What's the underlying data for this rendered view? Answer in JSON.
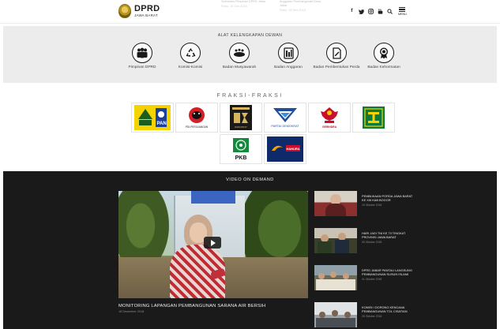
{
  "header": {
    "logo_title": "DPRD",
    "logo_subtitle": "JAWA BARAT",
    "ticker": [
      {
        "title": "Sekretaris Pimpinan DPRD Jabar",
        "date": "Rabu, 19 Des 2018"
      },
      {
        "title": "Anggaran Pembangunan Desa Jabar",
        "date": "Rabu, 19 Des 2018"
      }
    ],
    "icons": [
      "facebook-icon",
      "twitter-icon",
      "instagram-icon",
      "youtube-icon",
      "search-icon"
    ],
    "menu_label": "MENU"
  },
  "akd": {
    "title": "ALAT KELENGKAPAN DEWAN",
    "items": [
      {
        "label": "Pimpinan DPRD",
        "icon": "group-icon"
      },
      {
        "label": "Komisi-Komisi",
        "icon": "recycle-icon"
      },
      {
        "label": "Badan Musyawarah",
        "icon": "meeting-icon"
      },
      {
        "label": "Badan Anggaran",
        "icon": "budget-icon"
      },
      {
        "label": "Badan Pembentukan Perda",
        "icon": "document-icon"
      },
      {
        "label": "Badan Kehormatan",
        "icon": "medal-icon"
      }
    ]
  },
  "fraksi": {
    "title": "FRAKSI-FRAKSI",
    "parties": [
      {
        "name": "Golkar PAN",
        "icon": "golkar-pan-logo"
      },
      {
        "name": "PDI Perjuangan",
        "label": "PDI-PERJUANGAN",
        "icon": "pdip-logo"
      },
      {
        "name": "Demokrat Hanura",
        "label": "DEMOKRAT",
        "icon": "demokrat-logo"
      },
      {
        "name": "Partai Demokrat",
        "label": "PARTAI DEMOKRAT",
        "icon": "partai-demokrat-logo"
      },
      {
        "name": "Gerindra",
        "label": "GERINDRA",
        "icon": "gerindra-logo"
      },
      {
        "name": "PPP",
        "icon": "ppp-logo"
      },
      {
        "name": "PKB",
        "label": "PKB",
        "icon": "pkb-logo"
      },
      {
        "name": "Nasdem Hanura",
        "label": "HANURA",
        "icon": "nasdem-hanura-logo"
      }
    ]
  },
  "video": {
    "title": "VIDEO ON DEMAND",
    "main": {
      "title": "MONITORING LAPANGAN PEMBANGUNAN SARANA AIR BERSIH",
      "date": "18 Desember 2018"
    },
    "list": [
      {
        "title": "PEMBUKAAN PORDA JAWA BARAT KE XIII KAB BOGOR",
        "date": "15 Oktober 2018"
      },
      {
        "title": "HARI JADI TNI KE 73 TINGKAT PROVINSI JAWA BARAT",
        "date": "05 Oktober 2018"
      },
      {
        "title": "DPRD JABAR PANTAU LANGSUNG PEMBANGUNAN SUSUN ISLAMI",
        "date": "01 Oktober 2018"
      },
      {
        "title": "KOMISI I DORONG KENCANA PEMBANGUNAN TOL CISATIAN",
        "date": "26 Oktober 2018"
      }
    ]
  },
  "colors": {
    "video_bg": "#1a1a1a",
    "akd_bg": "#ececec",
    "golkar_yellow": "#f5d300",
    "pan_blue": "#1c3f9c",
    "pdip_red": "#d41f26",
    "demokrat_blue": "#1f4f9c",
    "gerindra_red": "#c8102e",
    "ppp_green": "#0e7a3a",
    "pkb_green": "#138a3c",
    "nasdem_navy": "#0f2a6b"
  }
}
